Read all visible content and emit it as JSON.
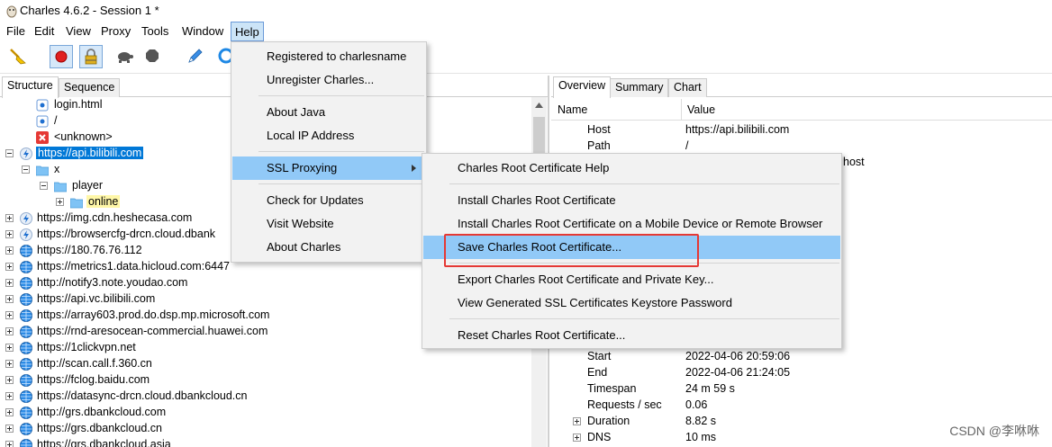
{
  "window": {
    "title": "Charles 4.6.2 - Session 1 *"
  },
  "menubar": [
    "File",
    "Edit",
    "View",
    "Proxy",
    "Tools",
    "Window",
    "Help"
  ],
  "left_tabs": [
    "Structure",
    "Sequence"
  ],
  "tree": [
    {
      "text": "login.html",
      "icon": "file-icon"
    },
    {
      "text": "/",
      "icon": "file-icon"
    },
    {
      "text": "<unknown>",
      "icon": "error-icon"
    },
    {
      "text": "https://api.bilibili.com",
      "icon": "lightning-icon"
    },
    {
      "text": "x",
      "icon": "folder-icon"
    },
    {
      "text": "player",
      "icon": "folder-icon"
    },
    {
      "text": "online",
      "icon": "folder-icon"
    },
    {
      "text": "https://img.cdn.heshecasa.com",
      "icon": "lightning-icon"
    },
    {
      "text": "https://browsercfg-drcn.cloud.dbank",
      "icon": "lightning-icon"
    },
    {
      "text": "https://180.76.76.112",
      "icon": "globe-icon"
    },
    {
      "text": "https://metrics1.data.hicloud.com:6447",
      "icon": "globe-icon"
    },
    {
      "text": "http://notify3.note.youdao.com",
      "icon": "globe-icon"
    },
    {
      "text": "https://api.vc.bilibili.com",
      "icon": "globe-icon"
    },
    {
      "text": "https://array603.prod.do.dsp.mp.microsoft.com",
      "icon": "globe-icon"
    },
    {
      "text": "https://rnd-aresocean-commercial.huawei.com",
      "icon": "globe-icon"
    },
    {
      "text": "https://1clickvpn.net",
      "icon": "globe-icon"
    },
    {
      "text": "http://scan.call.f.360.cn",
      "icon": "globe-icon"
    },
    {
      "text": "https://fclog.baidu.com",
      "icon": "globe-icon"
    },
    {
      "text": "https://datasync-drcn.cloud.dbankcloud.cn",
      "icon": "globe-icon"
    },
    {
      "text": "http://grs.dbankcloud.com",
      "icon": "globe-icon"
    },
    {
      "text": "https://grs.dbankcloud.cn",
      "icon": "globe-icon"
    },
    {
      "text": "https://grs.dbankcloud.asia",
      "icon": "globe-icon"
    }
  ],
  "right_tabs": [
    "Overview",
    "Summary",
    "Chart"
  ],
  "overview": {
    "columns": [
      "Name",
      "Value"
    ],
    "top_rows": [
      {
        "name": "Host",
        "value": "https://api.bilibili.com"
      },
      {
        "name": "Path",
        "value": "/"
      }
    ],
    "partial_value": "host",
    "bottom_rows": [
      {
        "name": "Start",
        "value": "2022-04-06 20:59:06"
      },
      {
        "name": "End",
        "value": "2022-04-06 21:24:05"
      },
      {
        "name": "Timespan",
        "value": "24 m 59 s"
      },
      {
        "name": "Requests / sec",
        "value": "0.06"
      },
      {
        "name": "Duration",
        "value": "8.82 s"
      },
      {
        "name": "DNS",
        "value": "10 ms"
      }
    ]
  },
  "help_menu": [
    "Registered to charlesname",
    "Unregister Charles...",
    "About Java",
    "Local IP Address",
    "SSL Proxying",
    "Check for Updates",
    "Visit Website",
    "About Charles"
  ],
  "ssl_menu": [
    "Charles Root Certificate Help",
    "Install Charles Root Certificate",
    "Install Charles Root Certificate on a Mobile Device or Remote Browser",
    "Save Charles Root Certificate...",
    "Export Charles Root Certificate and Private Key...",
    "View Generated SSL Certificates Keystore Password",
    "Reset Charles Root Certificate..."
  ],
  "watermark": "CSDN @李咻咻",
  "colors": {
    "selection": "#0078d7",
    "menu_hover": "#91c9f7",
    "annotation": "#e53935",
    "highlight": "#fff7a8"
  }
}
